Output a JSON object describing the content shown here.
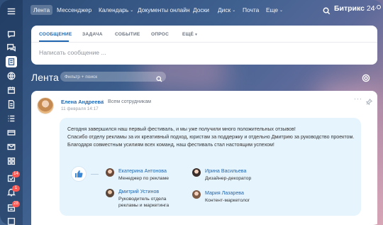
{
  "topnav": {
    "items": [
      {
        "label": "Лента",
        "active": true,
        "caret": false
      },
      {
        "label": "Мессенджер",
        "active": false,
        "caret": false
      },
      {
        "label": "Календарь",
        "active": false,
        "caret": true
      },
      {
        "label": "Документы онлайн",
        "active": false,
        "caret": false
      },
      {
        "label": "Доски",
        "active": false,
        "caret": false
      },
      {
        "label": "Диск",
        "active": false,
        "caret": true
      },
      {
        "label": "Почта",
        "active": false,
        "caret": false
      },
      {
        "label": "Еще",
        "active": false,
        "caret": true
      }
    ],
    "brand": "Битрикс",
    "brand_version": "24",
    "more": "···"
  },
  "sidebar": {
    "badges": [
      "14",
      "1",
      "28"
    ]
  },
  "composer": {
    "tabs": [
      "СООБЩЕНИЕ",
      "ЗАДАЧА",
      "СОБЫТИЕ",
      "ОПРОС",
      "ЕЩЁ"
    ],
    "placeholder": "Написать сообщение ..."
  },
  "feed": {
    "title": "Лента",
    "filter_placeholder": "Фильтр + поиск"
  },
  "post": {
    "author": "Елена Андреева",
    "recipients": "Всем сотрудникам",
    "date": "11 февраля 14:17",
    "more": "···",
    "message": [
      "Сегодня завершился наш первый фестиваль, и мы уже получили много положительных отзывов!",
      "Спасибо отделу рекламы за их креативный подход, юристам за поддержку и отдельно Дмитрию за руководство проектом.",
      "Благодаря совместным усилиям всех команд, наш фестиваль стал настоящим успехом!"
    ],
    "thanked": [
      {
        "name": "Екатерина Антонова",
        "role": "Менеджер по рекламе"
      },
      {
        "name": "Ирина Васильева",
        "role": "Дизайнер-декоратор"
      },
      {
        "name": "Дмитрий Устинов",
        "role": "Руководитель отдела рекламы и маркетинга",
        "role_lines": [
          "Руководитель отдела",
          "рекламы и маркетинга"
        ]
      },
      {
        "name": "Мария Лазарева",
        "role": "Контент-маркетолог"
      }
    ]
  }
}
